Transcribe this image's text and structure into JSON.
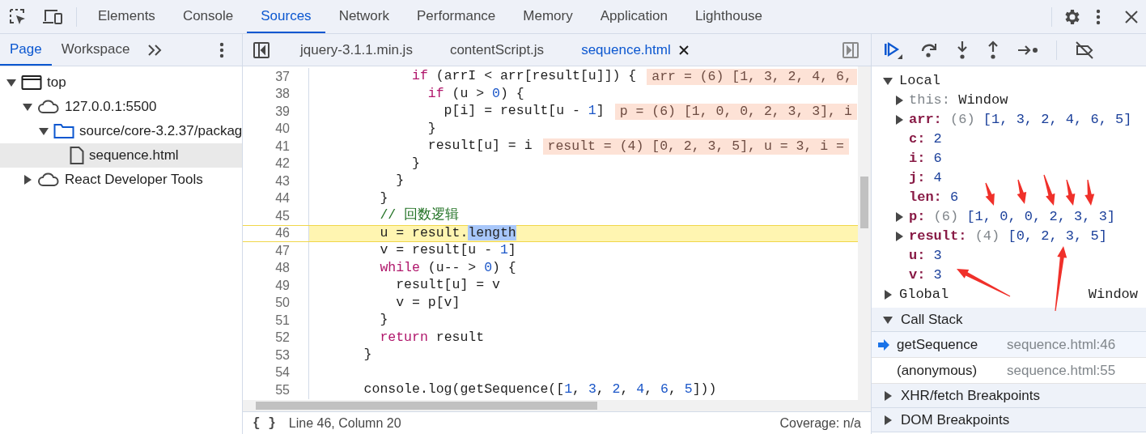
{
  "main_tabs": [
    {
      "label": "Elements",
      "selected": false
    },
    {
      "label": "Console",
      "selected": false
    },
    {
      "label": "Sources",
      "selected": true
    },
    {
      "label": "Network",
      "selected": false
    },
    {
      "label": "Performance",
      "selected": false
    },
    {
      "label": "Memory",
      "selected": false
    },
    {
      "label": "Application",
      "selected": false
    },
    {
      "label": "Lighthouse",
      "selected": false
    }
  ],
  "navigator": {
    "tabs": [
      {
        "label": "Page",
        "selected": true
      },
      {
        "label": "Workspace",
        "selected": false
      }
    ],
    "tree": [
      {
        "label": "top",
        "kind": "frame",
        "expanded": true,
        "selected": false,
        "children": [
          {
            "label": "127.0.0.1:5500",
            "kind": "cloud",
            "expanded": true,
            "selected": false,
            "children": [
              {
                "label": "source/core-3.2.37/packag",
                "kind": "folder",
                "expanded": true,
                "selected": false,
                "children": [
                  {
                    "label": "sequence.html",
                    "kind": "file",
                    "selected": true
                  }
                ]
              }
            ]
          },
          {
            "label": "React Developer Tools",
            "kind": "cloud",
            "expanded": false,
            "selected": false
          }
        ]
      }
    ]
  },
  "editor": {
    "tabs": [
      {
        "label": "jquery-3.1.1.min.js",
        "selected": false
      },
      {
        "label": "contentScript.js",
        "selected": false
      },
      {
        "label": "sequence.html",
        "selected": true
      }
    ],
    "lines": [
      {
        "number": "37",
        "current": false,
        "tokens": [
          {
            "kind": "keyword",
            "text": "          if"
          },
          {
            "kind": "plain",
            "text": " (arrI < arr[result[u]]) {"
          }
        ],
        "inline_value": "arr = (6) [1, 3, 2, 4, 6,"
      },
      {
        "number": "38",
        "current": false,
        "tokens": [
          {
            "kind": "keyword",
            "text": "            if"
          },
          {
            "kind": "plain",
            "text": " (u > "
          },
          {
            "kind": "number",
            "text": "0"
          },
          {
            "kind": "plain",
            "text": ") {"
          }
        ]
      },
      {
        "number": "39",
        "current": false,
        "tokens": [
          {
            "kind": "plain",
            "text": "              p[i] = result[u - "
          },
          {
            "kind": "number",
            "text": "1"
          },
          {
            "kind": "plain",
            "text": "]"
          }
        ],
        "inline_value": "p = (6) [1, 0, 0, 2, 3, 3], i"
      },
      {
        "number": "40",
        "current": false,
        "tokens": [
          {
            "kind": "plain",
            "text": "            }"
          }
        ]
      },
      {
        "number": "41",
        "current": false,
        "tokens": [
          {
            "kind": "plain",
            "text": "            result[u] = i"
          }
        ],
        "inline_value": "result = (4) [0, 2, 3, 5], u = 3, i ="
      },
      {
        "number": "42",
        "current": false,
        "tokens": [
          {
            "kind": "plain",
            "text": "          }"
          }
        ]
      },
      {
        "number": "43",
        "current": false,
        "tokens": [
          {
            "kind": "plain",
            "text": "        }"
          }
        ]
      },
      {
        "number": "44",
        "current": false,
        "tokens": [
          {
            "kind": "plain",
            "text": "      }"
          }
        ]
      },
      {
        "number": "45",
        "current": false,
        "tokens": [
          {
            "kind": "comment",
            "text": "      // 回数逻辑"
          }
        ]
      },
      {
        "number": "46",
        "current": true,
        "tokens": [
          {
            "kind": "plain",
            "text": "      u = result."
          },
          {
            "kind": "selection",
            "text": "length"
          }
        ]
      },
      {
        "number": "47",
        "current": false,
        "tokens": [
          {
            "kind": "plain",
            "text": "      v = result[u - "
          },
          {
            "kind": "number",
            "text": "1"
          },
          {
            "kind": "plain",
            "text": "]"
          }
        ]
      },
      {
        "number": "48",
        "current": false,
        "tokens": [
          {
            "kind": "keyword",
            "text": "      while"
          },
          {
            "kind": "plain",
            "text": " (u-- > "
          },
          {
            "kind": "number",
            "text": "0"
          },
          {
            "kind": "plain",
            "text": ") {"
          }
        ]
      },
      {
        "number": "49",
        "current": false,
        "tokens": [
          {
            "kind": "plain",
            "text": "        result[u] = v"
          }
        ]
      },
      {
        "number": "50",
        "current": false,
        "tokens": [
          {
            "kind": "plain",
            "text": "        v = p[v]"
          }
        ]
      },
      {
        "number": "51",
        "current": false,
        "tokens": [
          {
            "kind": "plain",
            "text": "      }"
          }
        ]
      },
      {
        "number": "52",
        "current": false,
        "tokens": [
          {
            "kind": "keyword",
            "text": "      return"
          },
          {
            "kind": "plain",
            "text": " result"
          }
        ]
      },
      {
        "number": "53",
        "current": false,
        "tokens": [
          {
            "kind": "plain",
            "text": "    }"
          }
        ]
      },
      {
        "number": "54",
        "current": false
      },
      {
        "number": "55",
        "current": false,
        "tokens": [
          {
            "kind": "plain",
            "text": "    console.log(getSequence(["
          },
          {
            "kind": "number",
            "text": "1"
          },
          {
            "kind": "plain",
            "text": ", "
          },
          {
            "kind": "number",
            "text": "3"
          },
          {
            "kind": "plain",
            "text": ", "
          },
          {
            "kind": "number",
            "text": "2"
          },
          {
            "kind": "plain",
            "text": ", "
          },
          {
            "kind": "number",
            "text": "4"
          },
          {
            "kind": "plain",
            "text": ", "
          },
          {
            "kind": "number",
            "text": "6"
          },
          {
            "kind": "plain",
            "text": ", "
          },
          {
            "kind": "number",
            "text": "5"
          },
          {
            "kind": "plain",
            "text": "]))"
          }
        ]
      }
    ]
  },
  "status_bar": {
    "format_button": "{ }",
    "position": "Line 46, Column 20",
    "coverage": "Coverage: n/a"
  },
  "scope": {
    "local": {
      "label": "Local",
      "expanded": true,
      "items": [
        {
          "name": "this:",
          "kind": "this",
          "expandable": true,
          "value": "Window"
        },
        {
          "name": "arr:",
          "kind": "number",
          "expandable": true,
          "count": "(6)",
          "value": "[1, 3, 2, 4, 6, 5]"
        },
        {
          "name": "c:",
          "kind": "number",
          "expandable": false,
          "value": "2"
        },
        {
          "name": "i:",
          "kind": "number",
          "expandable": false,
          "value": "6"
        },
        {
          "name": "j:",
          "kind": "number",
          "expandable": false,
          "value": "4"
        },
        {
          "name": "len:",
          "kind": "number",
          "expandable": false,
          "value": "6"
        },
        {
          "name": "p:",
          "kind": "number",
          "expandable": true,
          "count": "(6)",
          "value": "[1, 0, 0, 2, 3, 3]"
        },
        {
          "name": "result:",
          "kind": "number",
          "expandable": true,
          "count": "(4)",
          "value": "[0, 2, 3, 5]"
        },
        {
          "name": "u:",
          "kind": "number",
          "expandable": false,
          "value": "3"
        },
        {
          "name": "v:",
          "kind": "number",
          "expandable": false,
          "value": "3"
        }
      ]
    },
    "global": {
      "label": "Global",
      "value": "Window",
      "expanded": false
    }
  },
  "call_stack": {
    "label": "Call Stack",
    "expanded": true,
    "frames": [
      {
        "name": "getSequence",
        "location": "sequence.html:46",
        "selected": true
      },
      {
        "name": "(anonymous)",
        "location": "sequence.html:55",
        "selected": false
      }
    ]
  },
  "sections": [
    {
      "label": "XHR/fetch Breakpoints",
      "expanded": false
    },
    {
      "label": "DOM Breakpoints",
      "expanded": false
    }
  ]
}
